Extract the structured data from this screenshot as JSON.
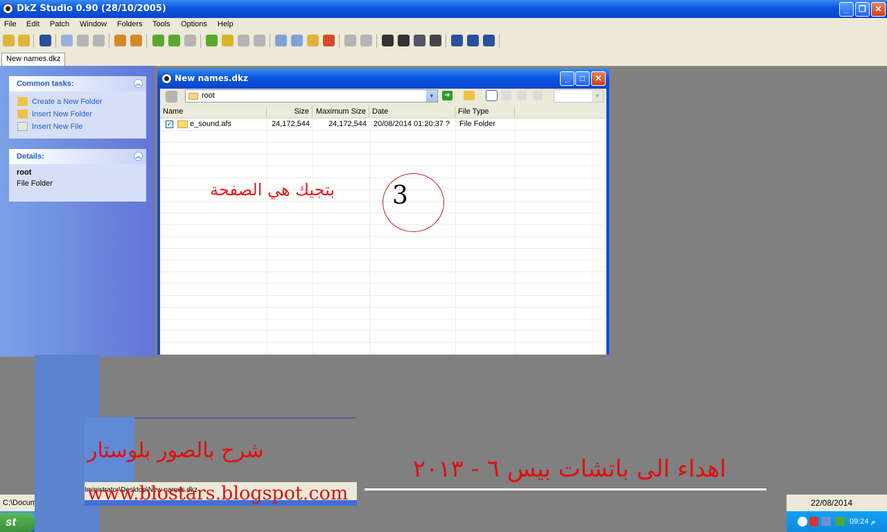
{
  "window": {
    "title": "DkZ Studio 0.90 (28/10/2005)"
  },
  "menu": [
    "File",
    "Edit",
    "Patch",
    "Window",
    "Folders",
    "Tools",
    "Options",
    "Help"
  ],
  "doc_tab": "New names.dkz",
  "task_pane": {
    "common_tasks_title": "Common tasks:",
    "links": [
      "Create a New Folder",
      "Insert New Folder",
      "Insert New File"
    ],
    "details_title": "Details:",
    "details_name": "root",
    "details_type": "File Folder"
  },
  "child": {
    "title": "New names.dkz",
    "path": "root",
    "columns": [
      "Name",
      "Size",
      "Maximum Size",
      "Date",
      "File Type"
    ],
    "rows": [
      {
        "name": "e_sound.afs",
        "size": "24,172,544",
        "max_size": "24,172,544",
        "date": "20/08/2014 01:20:37 ?",
        "type": "File Folder",
        "checked": true
      }
    ]
  },
  "annotation": {
    "text": "بتجيك هي الصفحة",
    "step": "3"
  },
  "overlay": {
    "promo": "شرح بالصور بلوستار",
    "url": "www.blostars.blogspot.com",
    "dedication": "اهداء الى باتشات بيس ٦ - ٢٠١٣",
    "screenshot_path": "Iministrator\\Desktop\\New names.dkz"
  },
  "status": {
    "path": "C:\\Docum",
    "date": "22/08/2014"
  },
  "taskbar": {
    "start": "st",
    "clock": "09:24 م"
  },
  "colors": {
    "accent": "#0a55e0",
    "annotation": "#e02020"
  }
}
